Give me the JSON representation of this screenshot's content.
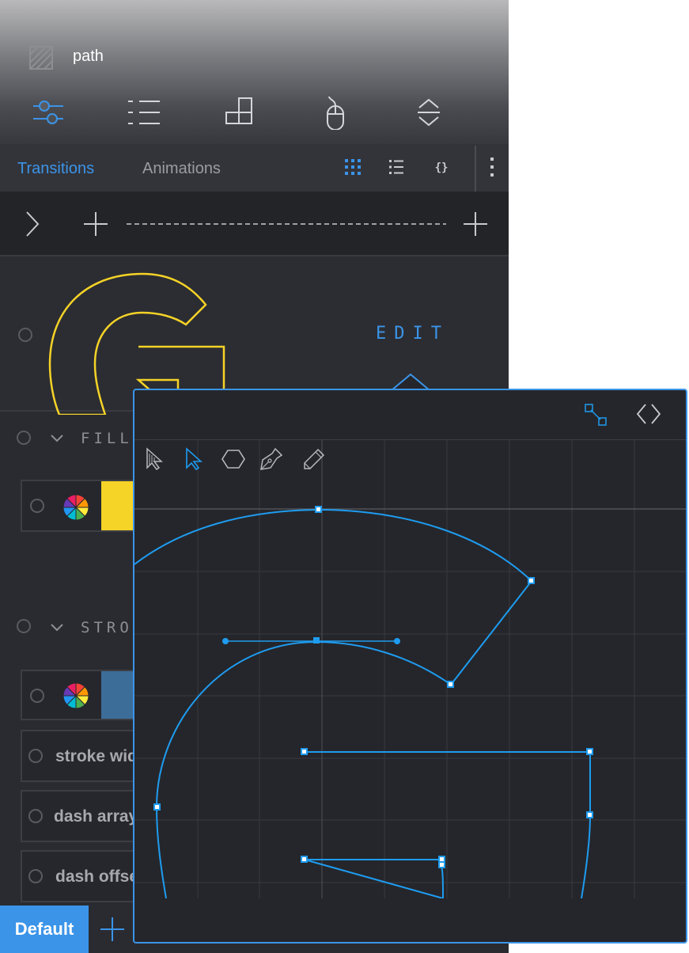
{
  "header": {
    "title": "path",
    "tools": [
      "sliders-icon",
      "list-icon",
      "blocks-icon",
      "mouse-icon",
      "expand-collapse-icon"
    ]
  },
  "tabs": [
    {
      "label": "Transitions",
      "active": true
    },
    {
      "label": "Animations",
      "active": false
    }
  ],
  "view_modes": [
    "grid-view-icon",
    "list-view-icon",
    "code-view-icon"
  ],
  "preview": {
    "edit_label": "EDIT",
    "glyph_color": "#f5d327"
  },
  "fill": {
    "label": "FILL",
    "color": "#f5d327"
  },
  "stroke": {
    "label": "STROKE",
    "color": "#3c6d99",
    "rows": [
      {
        "label": "stroke width"
      },
      {
        "label": "dash array"
      },
      {
        "label": "dash offset"
      }
    ]
  },
  "footer": {
    "default_label": "Default"
  },
  "editor": {
    "tools": [
      "direct-select-icon",
      "select-arrow-icon",
      "polygon-icon",
      "pen-icon",
      "pencil-icon"
    ],
    "accent": "#1e9cf0"
  },
  "colors": {
    "accent": "#3b94e8",
    "panel_bg": "#2a2b30"
  }
}
